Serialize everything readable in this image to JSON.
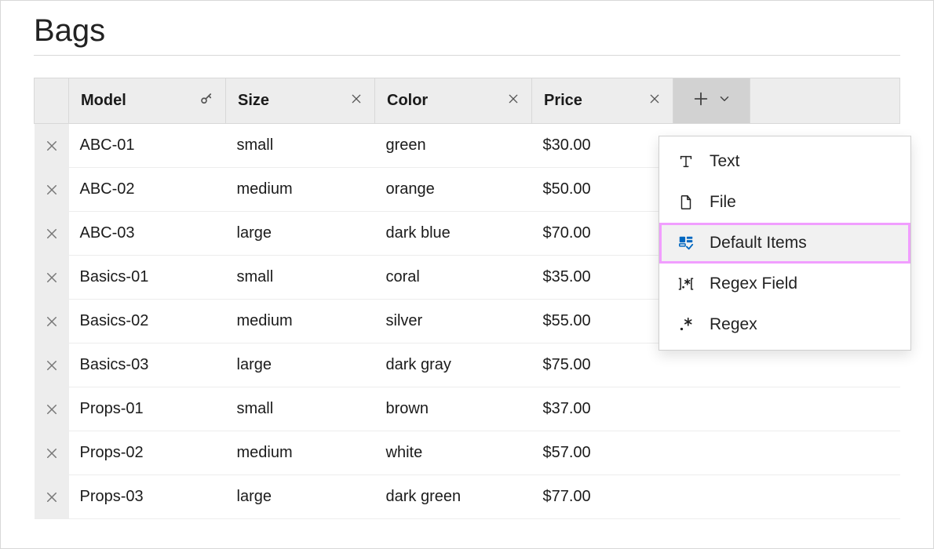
{
  "title": "Bags",
  "columns": {
    "model": "Model",
    "size": "Size",
    "color": "Color",
    "price": "Price"
  },
  "rows": [
    {
      "model": "ABC-01",
      "size": "small",
      "color": "green",
      "price": "$30.00"
    },
    {
      "model": "ABC-02",
      "size": "medium",
      "color": "orange",
      "price": "$50.00"
    },
    {
      "model": "ABC-03",
      "size": "large",
      "color": "dark blue",
      "price": "$70.00"
    },
    {
      "model": "Basics-01",
      "size": "small",
      "color": "coral",
      "price": "$35.00"
    },
    {
      "model": "Basics-02",
      "size": "medium",
      "color": "silver",
      "price": "$55.00"
    },
    {
      "model": "Basics-03",
      "size": "large",
      "color": "dark gray",
      "price": "$75.00"
    },
    {
      "model": "Props-01",
      "size": "small",
      "color": "brown",
      "price": "$37.00"
    },
    {
      "model": "Props-02",
      "size": "medium",
      "color": "white",
      "price": "$57.00"
    },
    {
      "model": "Props-03",
      "size": "large",
      "color": "dark green",
      "price": "$77.00"
    }
  ],
  "menu": {
    "text": "Text",
    "file": "File",
    "default_items": "Default Items",
    "regex_field": "Regex Field",
    "regex": "Regex"
  }
}
